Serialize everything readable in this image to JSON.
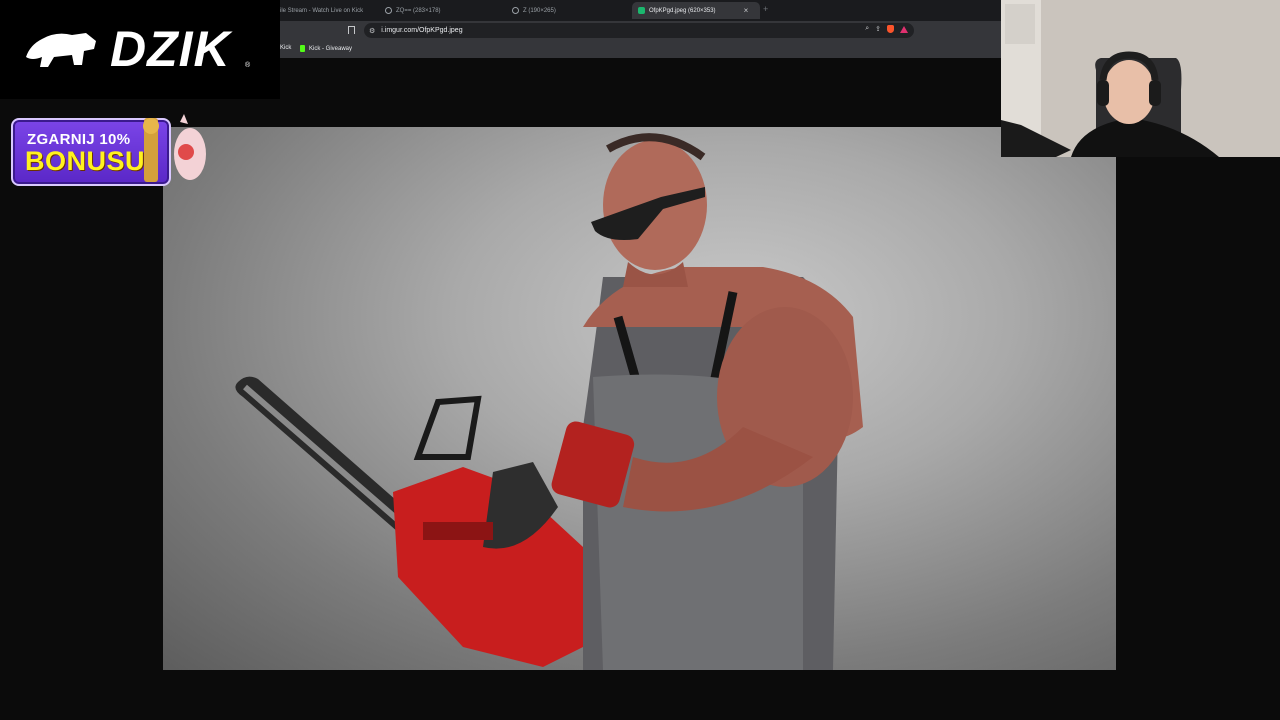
{
  "browser": {
    "tabs": [
      {
        "label": "ile Stream - Watch Live on Kick",
        "active": false,
        "icon": "kick-favicon"
      },
      {
        "label": "ZQ== (283×178)",
        "active": false,
        "icon": "globe-icon"
      },
      {
        "label": "Z (190×265)",
        "active": false,
        "icon": "globe-icon"
      },
      {
        "label": "OfpKPgd.jpeg (620×353)",
        "active": true,
        "icon": "imgur-favicon"
      }
    ],
    "close_symbol": "×",
    "new_tab_symbol": "+",
    "address_bar": {
      "url": "i.imgur.com/OfpKPgd.jpeg"
    },
    "bookmarks": [
      {
        "label": "Kick",
        "icon": "none"
      },
      {
        "label": "Kick - Giveaway",
        "icon": "kick-favicon"
      }
    ]
  },
  "stream_overlay": {
    "logo_text": "DZIK",
    "logo_registered": "®",
    "bonus_banner": {
      "line1": "ZGARNIJ 10%",
      "line2": "BONUSU"
    }
  },
  "viewer": {
    "image_subject": "man with eye patch holding a red chainsaw",
    "background_color": "#0b0b0b"
  },
  "colors": {
    "brand_purple": "#6a35d8",
    "bonus_yellow": "#fff21e",
    "kick_green": "#53fc18",
    "chainsaw_red": "#c81e1e"
  }
}
